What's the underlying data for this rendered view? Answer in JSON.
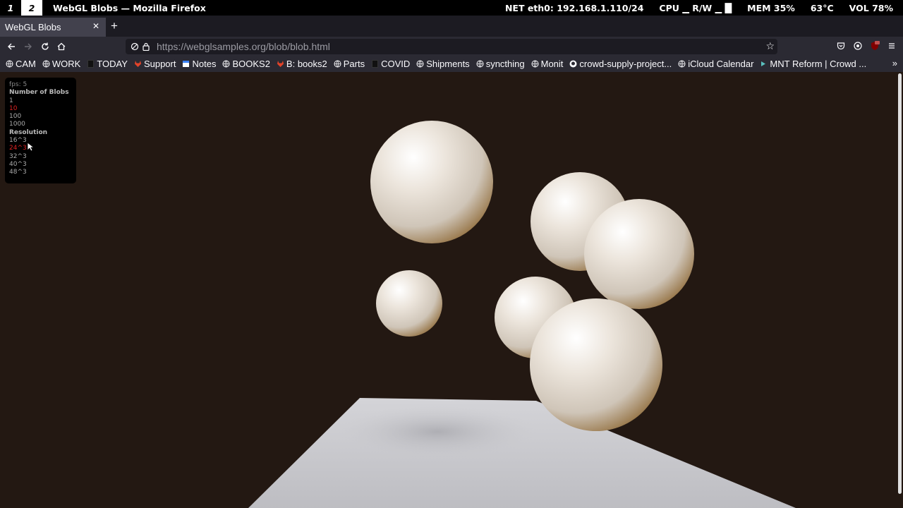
{
  "wm": {
    "workspaces": [
      "1",
      "2"
    ],
    "title": "WebGL Blobs — Mozilla Firefox",
    "status": {
      "net": "NET eth0: 192.168.1.110/24",
      "cpu": "CPU ▁ R/W ▁ █",
      "mem": "MEM 35%",
      "temp": "63°C",
      "vol": "VOL 78%"
    }
  },
  "tab": {
    "title": "WebGL Blobs"
  },
  "url": {
    "domain": "https://webglsamples.org",
    "path": "/blob/blob.html"
  },
  "bookmarks": [
    {
      "label": "CAM",
      "icon": "globe-icon"
    },
    {
      "label": "WORK",
      "icon": "globe-icon"
    },
    {
      "label": "TODAY",
      "icon": "page-icon"
    },
    {
      "label": "Support",
      "icon": "gitlab-icon"
    },
    {
      "label": "Notes",
      "icon": "notes-icon"
    },
    {
      "label": "BOOKS2",
      "icon": "globe-icon"
    },
    {
      "label": "B: books2",
      "icon": "gitlab-icon"
    },
    {
      "label": "Parts",
      "icon": "globe-icon"
    },
    {
      "label": "COVID",
      "icon": "page-icon"
    },
    {
      "label": "Shipments",
      "icon": "globe-icon"
    },
    {
      "label": "syncthing",
      "icon": "globe-icon"
    },
    {
      "label": "Monit",
      "icon": "globe-icon"
    },
    {
      "label": "crowd-supply-project...",
      "icon": "github-icon"
    },
    {
      "label": "iCloud Calendar",
      "icon": "globe-icon"
    },
    {
      "label": "MNT Reform | Crowd ...",
      "icon": "arrow-icon"
    }
  ],
  "panel": {
    "fps": "fps: 5",
    "blobs_header": "Number of Blobs",
    "blob_options": [
      {
        "label": "1",
        "selected": false
      },
      {
        "label": "10",
        "selected": true
      },
      {
        "label": "100",
        "selected": false
      },
      {
        "label": "1000",
        "selected": false
      }
    ],
    "res_header": "Resolution",
    "res_options": [
      {
        "label": "16^3",
        "selected": false
      },
      {
        "label": "24^3",
        "selected": true
      },
      {
        "label": "32^3",
        "selected": false
      },
      {
        "label": "40^3",
        "selected": false
      },
      {
        "label": "48^3",
        "selected": false
      }
    ]
  },
  "colors": {
    "background": "#231812",
    "blob": "#e9e2d8",
    "floor": "#c8c8cc",
    "selected": "#dd2222"
  }
}
